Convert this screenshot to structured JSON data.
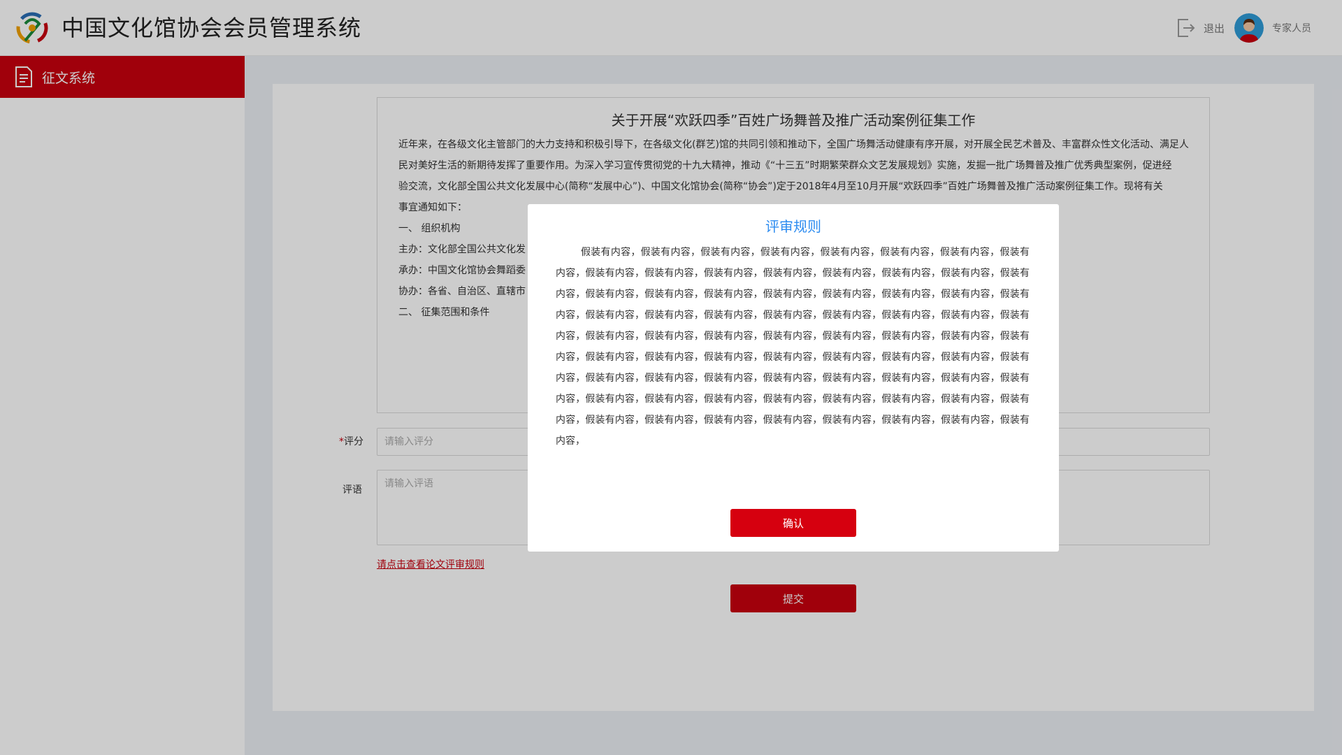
{
  "header": {
    "app_title": "中国文化馆协会会员管理系统",
    "logout_label": "退出",
    "user_label": "专家人员"
  },
  "sidebar": {
    "items": [
      {
        "label": "征文系统",
        "icon": "document-icon",
        "active": true
      }
    ]
  },
  "article": {
    "title": "关于开展“欢跃四季”百姓广场舞普及推广活动案例征集工作",
    "lines": [
      "近年来，在各级文化主管部门的大力支持和积极引导下，在各级文化(群艺)馆的共同引领和推动下，全国广场舞活动健康有序开展，对开展全民艺术普及、丰富群众性文化活动、满足人",
      "民对美好生活的新期待发挥了重要作用。为深入学习宣传贯彻党的十九大精神，推动《“十三五”时期繁荣群众文艺发展规划》实施，发掘一批广场舞普及推广优秀典型案例，促进经",
      "验交流，文化部全国公共文化发展中心(简称“发展中心”)、中国文化馆协会(简称“协会”)定于2018年4月至10月开展“欢跃四季”百姓广场舞普及推广活动案例征集工作。现将有关",
      "事宜通知如下：",
      "一、 组织机构",
      "主办：文化部全国公共文化发",
      "承办：中国文化馆协会舞蹈委",
      "协办：各省、自治区、直辖市",
      "二、 征集范围和条件"
    ]
  },
  "form": {
    "score_label": "评分",
    "score_required_mark": "*",
    "score_placeholder": "请输入评分",
    "comment_label": "评语",
    "comment_placeholder": "请输入评语",
    "rules_link": "请点击查看论文评审规则",
    "submit_label": "提交"
  },
  "modal": {
    "title": "评审规则",
    "body": "假装有内容，假装有内容，假装有内容，假装有内容，假装有内容，假装有内容，假装有内容，假装有内容，假装有内容，假装有内容，假装有内容，假装有内容，假装有内容，假装有内容，假装有内容，假装有内容，假装有内容，假装有内容，假装有内容，假装有内容，假装有内容，假装有内容，假装有内容，假装有内容，假装有内容，假装有内容，假装有内容，假装有内容，假装有内容，假装有内容，假装有内容，假装有内容，假装有内容，假装有内容，假装有内容，假装有内容，假装有内容，假装有内容，假装有内容，假装有内容，假装有内容，假装有内容，假装有内容，假装有内容，假装有内容，假装有内容，假装有内容，假装有内容，假装有内容，假装有内容，假装有内容，假装有内容，假装有内容，假装有内容，假装有内容，假装有内容，假装有内容，假装有内容，假装有内容，假装有内容，假装有内容，假装有内容，假装有内容，假装有内容，假装有内容，假装有内容，假装有内容，假装有内容，假装有内容，假装有内容，假装有内容，假装有内容，",
    "confirm_label": "确认"
  },
  "colors": {
    "brand_red": "#c8000e",
    "title_blue": "#2d8cf0",
    "main_bg": "#eceff4"
  }
}
